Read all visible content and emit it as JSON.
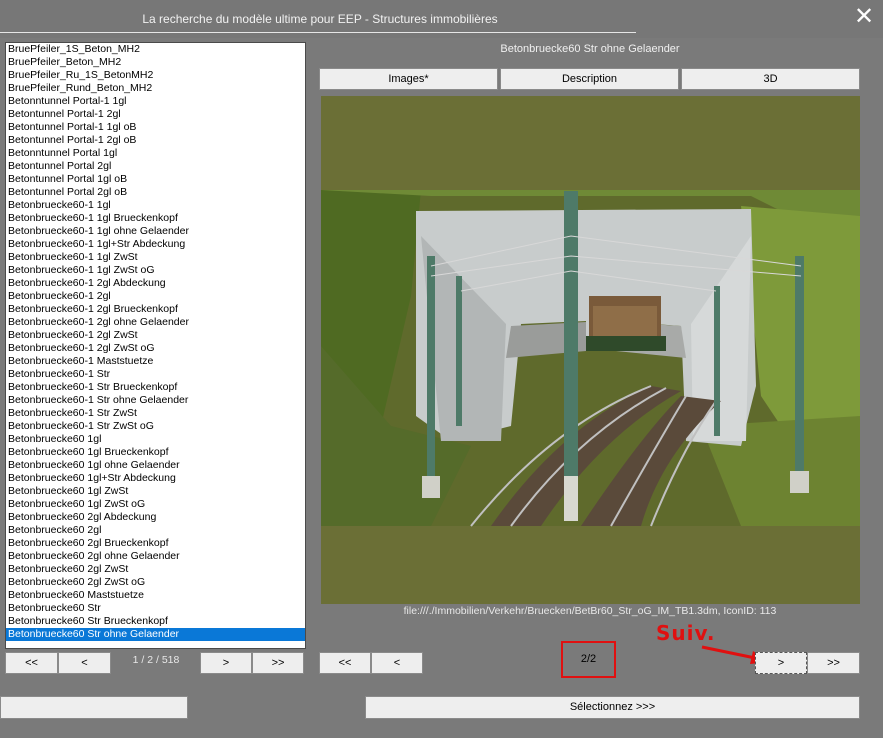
{
  "window": {
    "title": "La recherche du modèle ultime pour EEP - Structures immobilières",
    "close_glyph": "✕"
  },
  "list": {
    "items": [
      "BruePfeiler_1S_Beton_MH2",
      "BruePfeiler_Beton_MH2",
      "BruePfeiler_Ru_1S_BetonMH2",
      "BruePfeiler_Rund_Beton_MH2",
      "Betonntunnel Portal-1 1gl",
      "Betontunnel Portal-1 2gl",
      "Betontunnel Portal-1 1gl oB",
      "Betontunnel Portal-1 2gl oB",
      "Betonntunnel Portal 1gl",
      "Betontunnel Portal 2gl",
      "Betontunnel Portal 1gl oB",
      "Betontunnel Portal 2gl oB",
      "Betonbruecke60-1 1gl",
      "Betonbruecke60-1 1gl Brueckenkopf",
      "Betonbruecke60-1 1gl ohne Gelaender",
      "Betonbruecke60-1 1gl+Str Abdeckung",
      "Betonbruecke60-1 1gl ZwSt",
      "Betonbruecke60-1 1gl ZwSt oG",
      "Betonbruecke60-1 2gl Abdeckung",
      "Betonbruecke60-1 2gl",
      "Betonbruecke60-1 2gl Brueckenkopf",
      "Betonbruecke60-1 2gl ohne Gelaender",
      "Betonbruecke60-1 2gl ZwSt",
      "Betonbruecke60-1 2gl ZwSt oG",
      "Betonbruecke60-1 Maststuetze",
      "Betonbruecke60-1 Str",
      "Betonbruecke60-1 Str Brueckenkopf",
      "Betonbruecke60-1 Str ohne Gelaender",
      "Betonbruecke60-1 Str ZwSt",
      "Betonbruecke60-1 Str ZwSt oG",
      "Betonbruecke60 1gl",
      "Betonbruecke60 1gl Brueckenkopf",
      "Betonbruecke60 1gl ohne Gelaender",
      "Betonbruecke60 1gl+Str Abdeckung",
      "Betonbruecke60 1gl ZwSt",
      "Betonbruecke60 1gl ZwSt oG",
      "Betonbruecke60 2gl Abdeckung",
      "Betonbruecke60 2gl",
      "Betonbruecke60 2gl Brueckenkopf",
      "Betonbruecke60 2gl ohne Gelaender",
      "Betonbruecke60 2gl ZwSt",
      "Betonbruecke60 2gl ZwSt oG",
      "Betonbruecke60 Maststuetze",
      "Betonbruecke60 Str",
      "Betonbruecke60 Str Brueckenkopf",
      "Betonbruecke60 Str ohne Gelaender"
    ],
    "selected_index": 45,
    "pager": {
      "first": "<<",
      "prev": "<",
      "status": "1 / 2 / 518",
      "next": ">",
      "last": ">>"
    }
  },
  "preview": {
    "caption": "Betonbruecke60 Str ohne Gelaender",
    "tabs": [
      "Images*",
      "Description",
      "3D"
    ],
    "image_alt": "3D render of concrete bridge with tracks and catenary masts",
    "file_info": "file:///./Immobilien/Verkehr/Bruecken/BetBr60_Str_oG_IM_TB1.3dm, IconID: 113",
    "pager": {
      "first": "<<",
      "prev": "<",
      "indicator": "2/2",
      "next": ">",
      "last": ">>"
    },
    "annotation": "Suiv."
  },
  "bottom": {
    "left_button": "",
    "select_button": "Sélectionnez >>>"
  },
  "colors": {
    "selection": "#0a78d7",
    "highlight": "#e01010",
    "background": "#7a7a7a"
  }
}
